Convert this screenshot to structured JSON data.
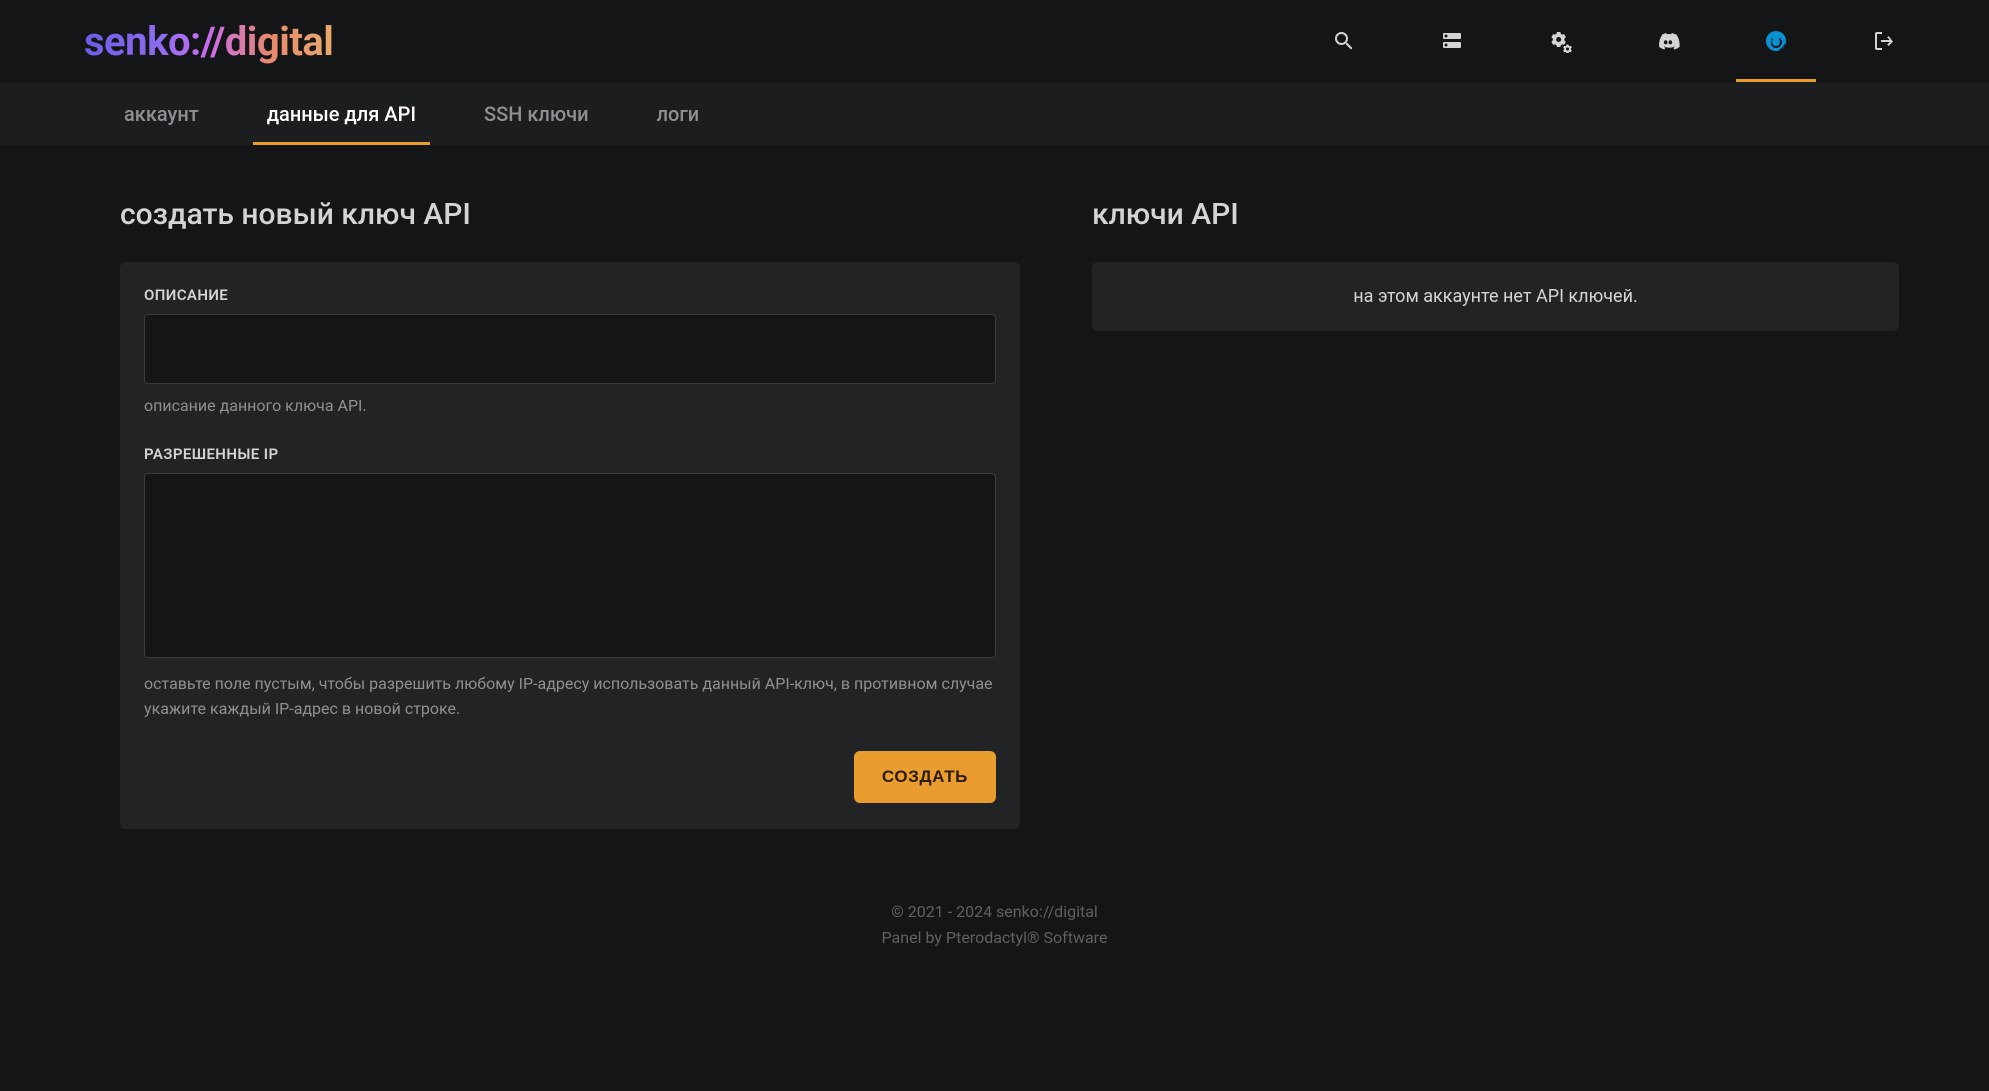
{
  "logo": "senko://digital",
  "topnav": {
    "search_label": "search",
    "servers_label": "servers",
    "admin_label": "admin",
    "discord_label": "discord",
    "account_label": "account",
    "logout_label": "logout"
  },
  "subnav": {
    "account": "аккаунт",
    "api": "данные для API",
    "ssh": "SSH ключи",
    "logs": "логи"
  },
  "left": {
    "title": "создать новый ключ API",
    "description_label": "ОПИСАНИЕ",
    "description_value": "",
    "description_help": "описание данного ключа API.",
    "allowed_ips_label": "РАЗРЕШЕННЫЕ IP",
    "allowed_ips_value": "",
    "allowed_ips_help": "оставьте поле пустым, чтобы разрешить любому IP-адресу использовать данный API-ключ, в противном случае укажите каждый IP-адрес в новой строке.",
    "submit_label": "СОЗДАТЬ"
  },
  "right": {
    "title": "ключи API",
    "empty_message": "на этом аккаунте нет API ключей."
  },
  "footer": {
    "line1": "© 2021 - 2024 senko://digital",
    "line2_prefix": "Panel by ",
    "line2_link": "Pterodactyl® Software"
  },
  "colors": {
    "accent_orange": "#e89d2e",
    "accent_blue": "#0891d1"
  }
}
